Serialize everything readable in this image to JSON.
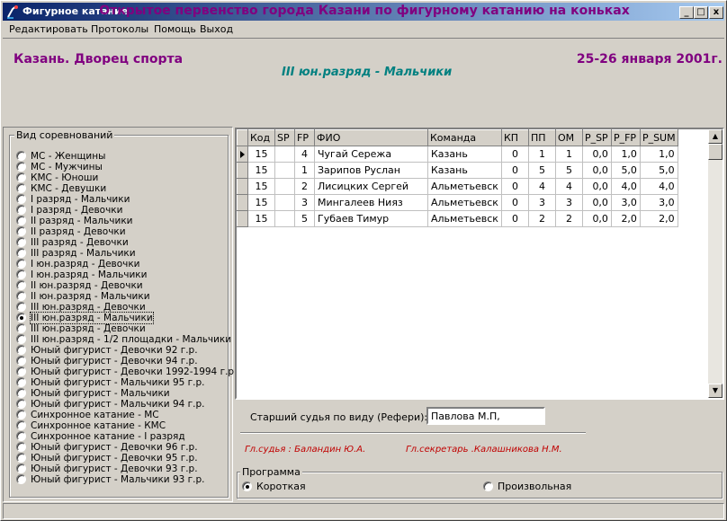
{
  "window": {
    "title": "Фигурное катание",
    "controls": {
      "minimize": "_",
      "maximize": "□",
      "close": "x"
    }
  },
  "menu": [
    "Редактировать",
    "Протоколы",
    "Помощь",
    "Выход"
  ],
  "header": {
    "title": "Открытое первенство города Казани по фигурному катанию на коньках",
    "place": "Казань. Дворец спорта",
    "dates": "25-26 января 2001г.",
    "category": "III юн.разряд  - Мальчики"
  },
  "competition_types": {
    "label": "Вид соревнований",
    "selected_index": 15,
    "items": [
      "МС - Женщины",
      "МС - Мужчины",
      "КМС - Юноши",
      "КМС - Девушки",
      "I разряд - Мальчики",
      "I разряд - Девочки",
      "II разряд - Мальчики",
      "II разряд - Девочки",
      "III разряд - Девочки",
      "III разряд - Мальчики",
      "I юн.разряд  - Девочки",
      "I юн.разряд  - Мальчики",
      "II юн.разряд  - Девочки",
      "II юн.разряд  - Мальчики",
      "III юн.разряд - Девочки",
      "III юн.разряд  - Мальчики",
      "III юн.разряд  - Девочки",
      "III юн.разряд  - 1/2 площадки - Мальчики",
      "Юный фигурист - Девочки 92 г.р.",
      "Юный фигурист - Девочки 94 г.р.",
      "Юный фигурист - Девочки 1992-1994 г.р.",
      "Юный фигурист - Мальчики 95 г.р.",
      "Юный фигурист - Мальчики",
      "Юный фигурист - Мальчики 94 г.р.",
      "Синхронное катание - МС",
      "Синхронное катание - КМС",
      "Синхронное катание - I разряд",
      "Юный фигурист - Девочки 96 г.р.",
      "Юный фигурист - Девочки 95 г.р.",
      "Юный фигурист - Девочки 93 г.р.",
      "Юный фигурист - Мальчики 93 г.р."
    ]
  },
  "grid": {
    "columns": [
      "Код",
      "SP",
      "FP",
      "ФИО",
      "Команда",
      "КП",
      "ПП",
      "ОМ",
      "P_SP",
      "P_FP",
      "P_SUM"
    ],
    "rows": [
      [
        "15",
        "",
        "4",
        "Чугай Сережа",
        "Казань",
        "0",
        "1",
        "1",
        "0,0",
        "1,0",
        "1,0"
      ],
      [
        "15",
        "",
        "1",
        "Зарипов Руслан",
        "Казань",
        "0",
        "5",
        "5",
        "0,0",
        "5,0",
        "5,0"
      ],
      [
        "15",
        "",
        "2",
        "Лисицких Сергей",
        "Альметьевск",
        "0",
        "4",
        "4",
        "0,0",
        "4,0",
        "4,0"
      ],
      [
        "15",
        "",
        "3",
        "Мингалеев Нияз",
        "Альметьевск",
        "0",
        "3",
        "3",
        "0,0",
        "3,0",
        "3,0"
      ],
      [
        "15",
        "",
        "5",
        "Губаев Тимур",
        "Альметьевск",
        "0",
        "2",
        "2",
        "0,0",
        "2,0",
        "2,0"
      ]
    ]
  },
  "referee": {
    "label": "Старший судья по виду (Рефери):",
    "value": "Павлова М.П,"
  },
  "officials": {
    "chief_judge": "Гл.судья :  Баландин Ю.А.",
    "chief_secretary": "Гл.секретарь .Калашникова Н.М."
  },
  "program": {
    "label": "Программа",
    "options": [
      "Короткая",
      "Произвольная"
    ],
    "selected_index": 0
  },
  "colors": {
    "title_text": "#800080",
    "category_text": "#008080",
    "officials_text": "#c00000",
    "titlebar_start": "#0a246a",
    "titlebar_end": "#a6caf0"
  }
}
